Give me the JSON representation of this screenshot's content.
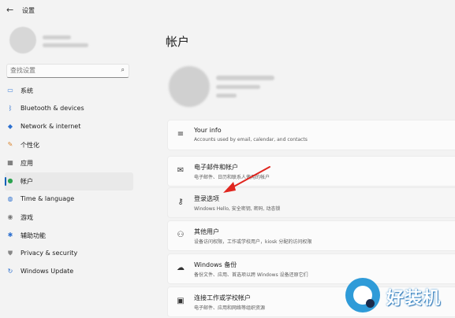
{
  "window": {
    "title": "设置",
    "back_glyph": "←"
  },
  "search": {
    "placeholder": "查找设置",
    "icon": "search-icon"
  },
  "nav": {
    "items": [
      {
        "label": "系统",
        "icon": "monitor-icon",
        "color": "#3c7fd8",
        "active": false
      },
      {
        "label": "Bluetooth & devices",
        "icon": "bluetooth-icon",
        "color": "#2b6fcf",
        "active": false
      },
      {
        "label": "Network & internet",
        "icon": "wifi-icon",
        "color": "#2b6fcf",
        "active": false
      },
      {
        "label": "个性化",
        "icon": "brush-icon",
        "color": "#d9822b",
        "active": false
      },
      {
        "label": "应用",
        "icon": "apps-icon",
        "color": "#555555",
        "active": false
      },
      {
        "label": "帐户",
        "icon": "person-icon",
        "color": "#2ca24f",
        "active": true
      },
      {
        "label": "Time & language",
        "icon": "globe-clock-icon",
        "color": "#2b6fcf",
        "active": false
      },
      {
        "label": "游戏",
        "icon": "gamepad-icon",
        "color": "#777777",
        "active": false
      },
      {
        "label": "辅助功能",
        "icon": "accessibility-icon",
        "color": "#2b6fcf",
        "active": false
      },
      {
        "label": "Privacy & security",
        "icon": "shield-icon",
        "color": "#888888",
        "active": false
      },
      {
        "label": "Windows Update",
        "icon": "update-icon",
        "color": "#2b6fcf",
        "active": false
      }
    ]
  },
  "main": {
    "title": "帐户",
    "cards": [
      {
        "title": "Your info",
        "subtitle": "Accounts used by email, calendar, and contacts",
        "icon": "user-info-icon"
      },
      {
        "title": "电子邮件和帐户",
        "subtitle": "电子邮件、日历和联系人使用的帐户",
        "icon": "mail-icon"
      },
      {
        "title": "登录选项",
        "subtitle": "Windows Hello, 安全密钥, 密码, 动态锁",
        "icon": "key-icon"
      },
      {
        "title": "其他用户",
        "subtitle": "设备访问权限，工作或学校用户，kiosk 分配的访问权限",
        "icon": "add-user-icon"
      },
      {
        "title": "Windows 备份",
        "subtitle": "备份文件、应用、首选项以跨 Windows 设备还原它们",
        "icon": "backup-icon"
      },
      {
        "title": "连接工作或学校帐户",
        "subtitle": "电子邮件、应用和网络等组织资源",
        "icon": "briefcase-icon"
      }
    ]
  },
  "annotation": {
    "color": "#e0261f"
  },
  "watermark": {
    "text": "好装机",
    "color": "#2f9bd8"
  }
}
